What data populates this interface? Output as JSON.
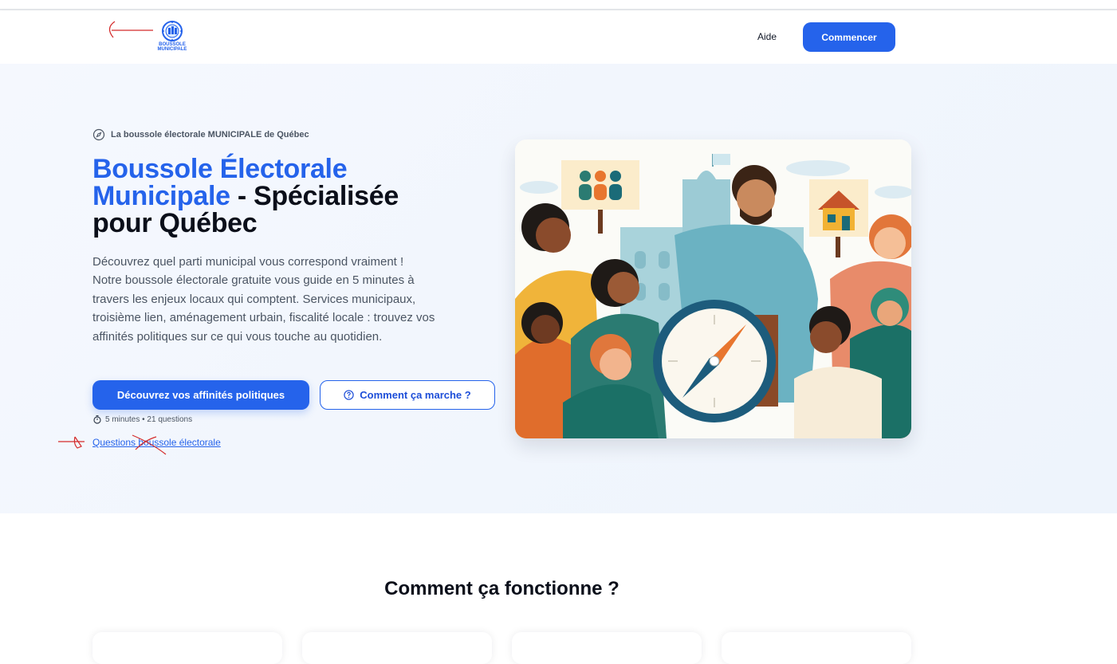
{
  "brand": {
    "logo_text_line1": "BOUSSOLE",
    "logo_text_line2": "MUNICIPALE"
  },
  "nav": {
    "help": "Aide",
    "cta": "Commencer"
  },
  "hero": {
    "eyebrow": "La boussole électorale MUNICIPALE de Québec",
    "title_accent": "Boussole Électorale Municipale",
    "title_rest": " - Spécialisée pour Québec",
    "description": "Découvrez quel parti municipal vous correspond vraiment ! Notre boussole électorale gratuite vous guide en 5 minutes à travers les enjeux locaux qui comptent. Services municipaux, troisième lien, aménagement urbain, fiscalité locale : trouvez vos affinités politiques sur ce qui vous touche au quotidien.",
    "primary_button": "Découvrez vos affinités politiques",
    "secondary_button": "Comment ça marche ?",
    "meta": "5 minutes • 21 questions",
    "faq_link": "Questions boussole électorale"
  },
  "how": {
    "title": "Comment ça fonctionne ?"
  },
  "colors": {
    "accent": "#2563eb",
    "annotation": "#d42b2b"
  }
}
